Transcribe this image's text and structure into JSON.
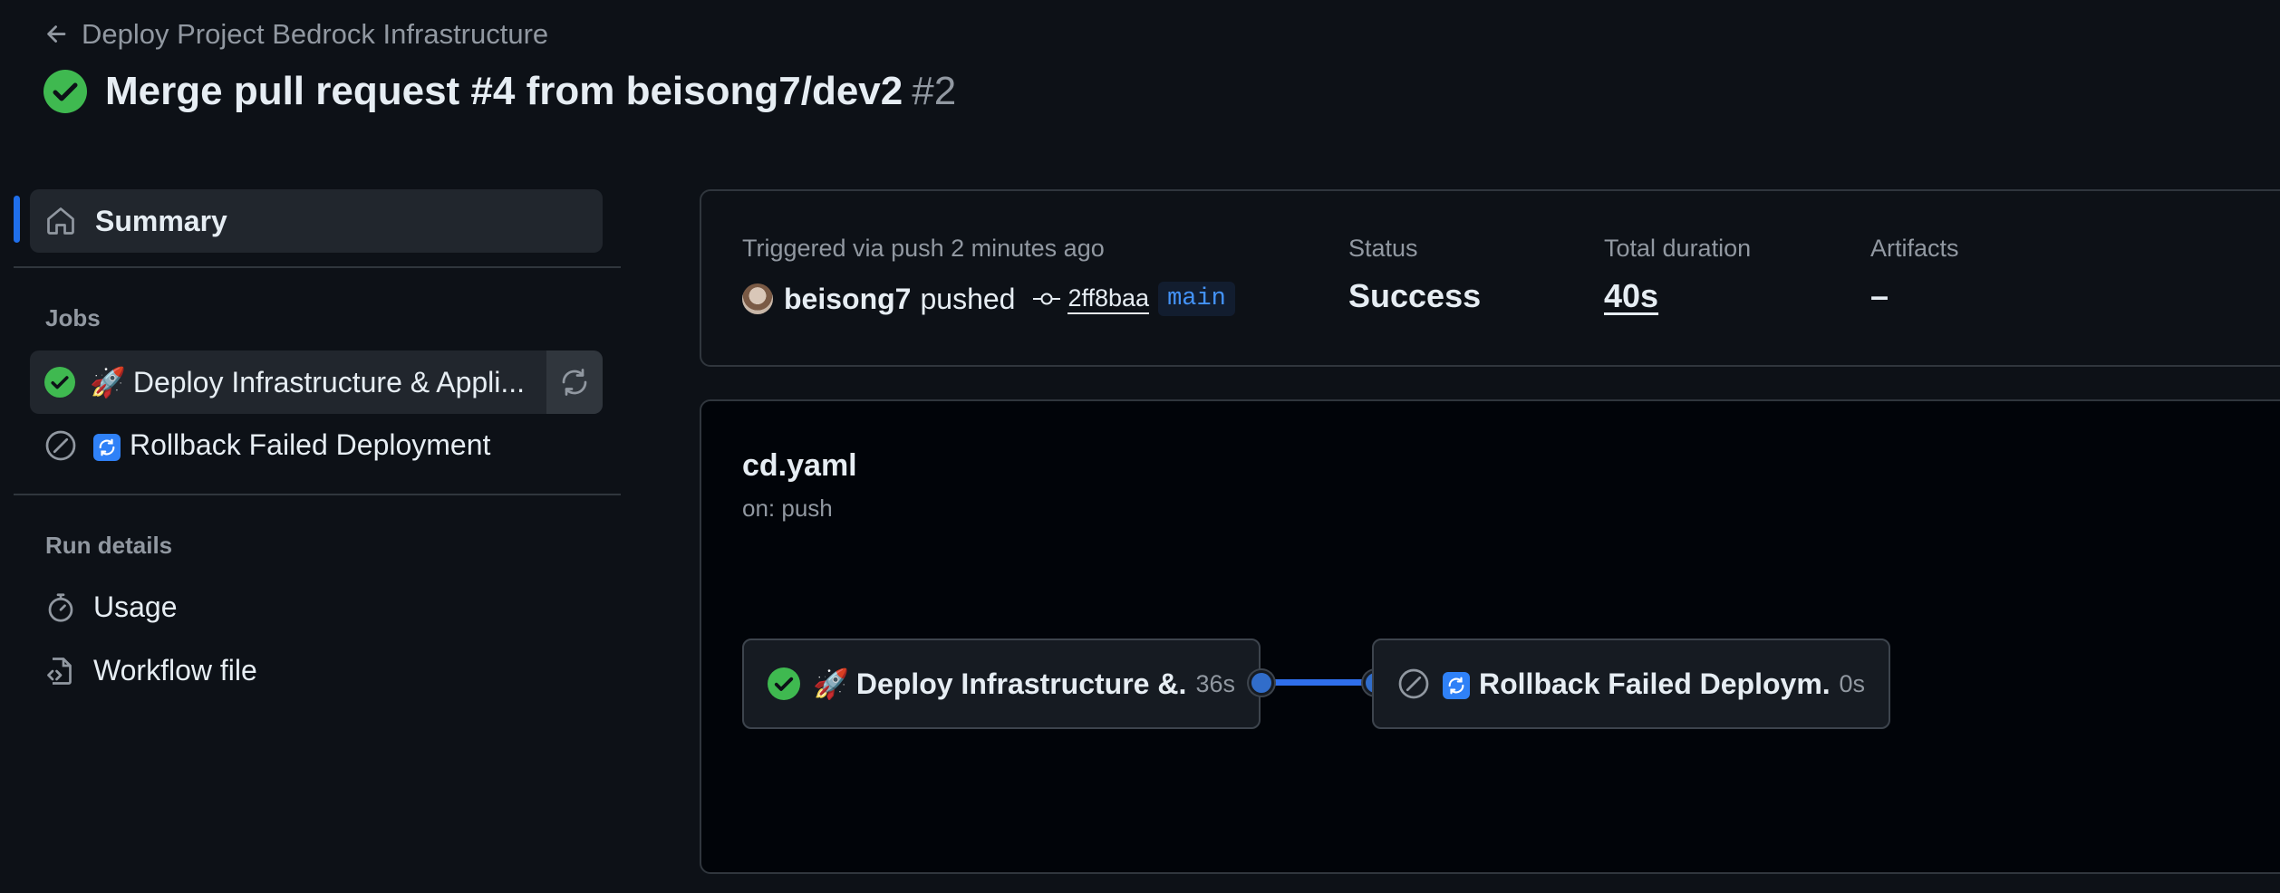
{
  "header": {
    "back_label": "Deploy Project Bedrock Infrastructure",
    "title": "Merge pull request #4 from beisong7/dev2",
    "run_number": "#2"
  },
  "sidebar": {
    "summary_label": "Summary",
    "jobs_heading": "Jobs",
    "jobs": [
      {
        "emoji": "🚀",
        "label": "Deploy Infrastructure & Appli...",
        "status": "success"
      },
      {
        "label": "Rollback Failed Deployment",
        "status": "skipped"
      }
    ],
    "run_details_heading": "Run details",
    "run_details": [
      {
        "label": "Usage",
        "icon": "stopwatch-icon"
      },
      {
        "label": "Workflow file",
        "icon": "file-code-icon"
      }
    ]
  },
  "summary": {
    "triggered_text": "Triggered via push 2 minutes ago",
    "user": "beisong7",
    "action": "pushed",
    "commit_sha": "2ff8baa",
    "branch": "main",
    "status_label": "Status",
    "status_value": "Success",
    "duration_label": "Total duration",
    "duration_value": "40s",
    "artifacts_label": "Artifacts",
    "artifacts_value": "–"
  },
  "graph": {
    "workflow_file": "cd.yaml",
    "trigger": "on: push",
    "nodes": [
      {
        "emoji": "🚀",
        "label": "Deploy Infrastructure &...",
        "duration": "36s",
        "status": "success"
      },
      {
        "label": "Rollback Failed Deploym...",
        "duration": "0s",
        "status": "skipped"
      }
    ]
  },
  "colors": {
    "background": "#0d1117",
    "success": "#3fb950",
    "accent": "#1f6feb",
    "muted_text": "#9198a1"
  }
}
